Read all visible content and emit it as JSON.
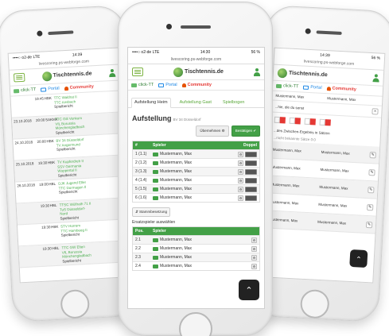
{
  "common": {
    "url": "livescoring.ps-webforge.com",
    "logo_text": "Tischtennis.de",
    "nav": {
      "click_tt": "click-TT",
      "portal": "Portal",
      "community": "Community"
    }
  },
  "left_phone": {
    "status": {
      "carrier": "••••○ o2-de  LTE",
      "time": "14:39",
      "battery": ""
    },
    "schedule": [
      {
        "date": "",
        "time": "19:45",
        "team": "HBK",
        "teams": [
          "TTC Waldrat II",
          "TTC Ansbach"
        ],
        "report": "Spielbericht",
        "alt": false
      },
      {
        "date": "23.10.2018",
        "time": "20:00",
        "team": "SAKMK",
        "teams": [
          "TTC Gill Venkum",
          "VfL Borussia",
          "Mönchengladbach"
        ],
        "report": "Spielbericht",
        "alt": true
      },
      {
        "date": "24.10.2018",
        "time": "20:00",
        "team": "HBK",
        "teams": [
          "BV 34 Düsseldorf",
          "TV Angermund"
        ],
        "report": "Spielbericht",
        "alt": false
      },
      {
        "date": "25.10.2018",
        "time": "19:30",
        "team": "HBK",
        "teams": [
          "TV Kupferdreh II",
          "SSV Germania",
          "Wuppertal II"
        ],
        "report": "Spielbericht",
        "alt": true
      },
      {
        "date": "26.10.2018",
        "time": "19:00",
        "team": "HBL",
        "teams": [
          "DJK Jugend Eller",
          "TTC Dormagen II"
        ],
        "report": "Spielbericht",
        "alt": false
      },
      {
        "date": "",
        "time": "19:30",
        "team": "HBL",
        "teams": [
          "TTSC Wülfrath 71 II",
          "TuS Düsseldorf-",
          "Nord"
        ],
        "report": "Spielbericht",
        "alt": true
      },
      {
        "date": "",
        "time": "19:30",
        "team": "HBK",
        "teams": [
          "STV Horrem",
          "TTC Hambeeg II"
        ],
        "report": "Spielbericht",
        "alt": false
      },
      {
        "date": "",
        "time": "19:30",
        "team": "HBL",
        "teams": [
          "TTC GW Elten",
          "VfL Borussia",
          "Mönchengladbach"
        ],
        "report": "Spielbericht",
        "alt": true
      }
    ]
  },
  "center_phone": {
    "status": {
      "carrier": "••••○ o2-de  LTE",
      "time": "14:30",
      "battery": "56 %"
    },
    "tabs": [
      "Aufstellung Heim",
      "Aufstellung Gast",
      "Spielbogen"
    ],
    "title": "Aufstellung",
    "title_sub": "BV 34 Düsseldorf",
    "btn_adopt": "Übernehmen",
    "btn_confirm": "Bestätigen",
    "lineup_headers": [
      "#",
      "Spieler",
      "Doppel"
    ],
    "lineup": [
      {
        "num": "1 (1.1)",
        "player": "Mustermann, Max"
      },
      {
        "num": "2 (1.2)",
        "player": "Mustermann, Max"
      },
      {
        "num": "3 (1.3)",
        "player": "Mustermann, Max"
      },
      {
        "num": "4 (1.4)",
        "player": "Mustermann, Max"
      },
      {
        "num": "5 (1.5)",
        "player": "Mustermann, Max"
      },
      {
        "num": "6 (1.6)",
        "player": "Mustermann, Max"
      }
    ],
    "master_btn": "Stammbesetzung",
    "replacement_caption": "Ersatzspieler auswählen",
    "reserve_headers": [
      "Pos.",
      "Spieler"
    ],
    "reserves": [
      {
        "pos": "2.1",
        "player": "Mustermann, Max"
      },
      {
        "pos": "2.2",
        "player": "Mustermann, Max"
      },
      {
        "pos": "2.3",
        "player": "Mustermann, Max"
      },
      {
        "pos": "2.4",
        "player": "Mustermann, Max"
      }
    ]
  },
  "right_phone": {
    "status": {
      "carrier": "",
      "time": "14:39",
      "battery": "56 %"
    },
    "rows": [
      {
        "a": "Mustermann, Max",
        "b": "Mustermann, Max",
        "alt": false
      }
    ],
    "hint_sign": "...hie, die du sonst",
    "note1": "...des Zwischen-Ergebnis in Sätzen",
    "note2": "...nicht bekannte Sätze 0:0",
    "bottom_rows": [
      {
        "a": "Mustermann, Max",
        "b": "Mustermann, Max",
        "alt": true
      },
      {
        "a": "Mustermann, Max",
        "b": "Mustermann, Max",
        "alt": false
      },
      {
        "a": "Mustermann, Max",
        "b": "Mustermann, Max",
        "alt": true
      },
      {
        "a": "Mustermann, Max",
        "b": "Mustermann, Max",
        "alt": false
      },
      {
        "a": "Mustermann, Max",
        "b": "Mustermann, Max",
        "alt": true
      }
    ]
  },
  "colors": {
    "brand_green": "#43a047",
    "accent_red": "#e53935",
    "link_blue": "#1e88e5"
  }
}
